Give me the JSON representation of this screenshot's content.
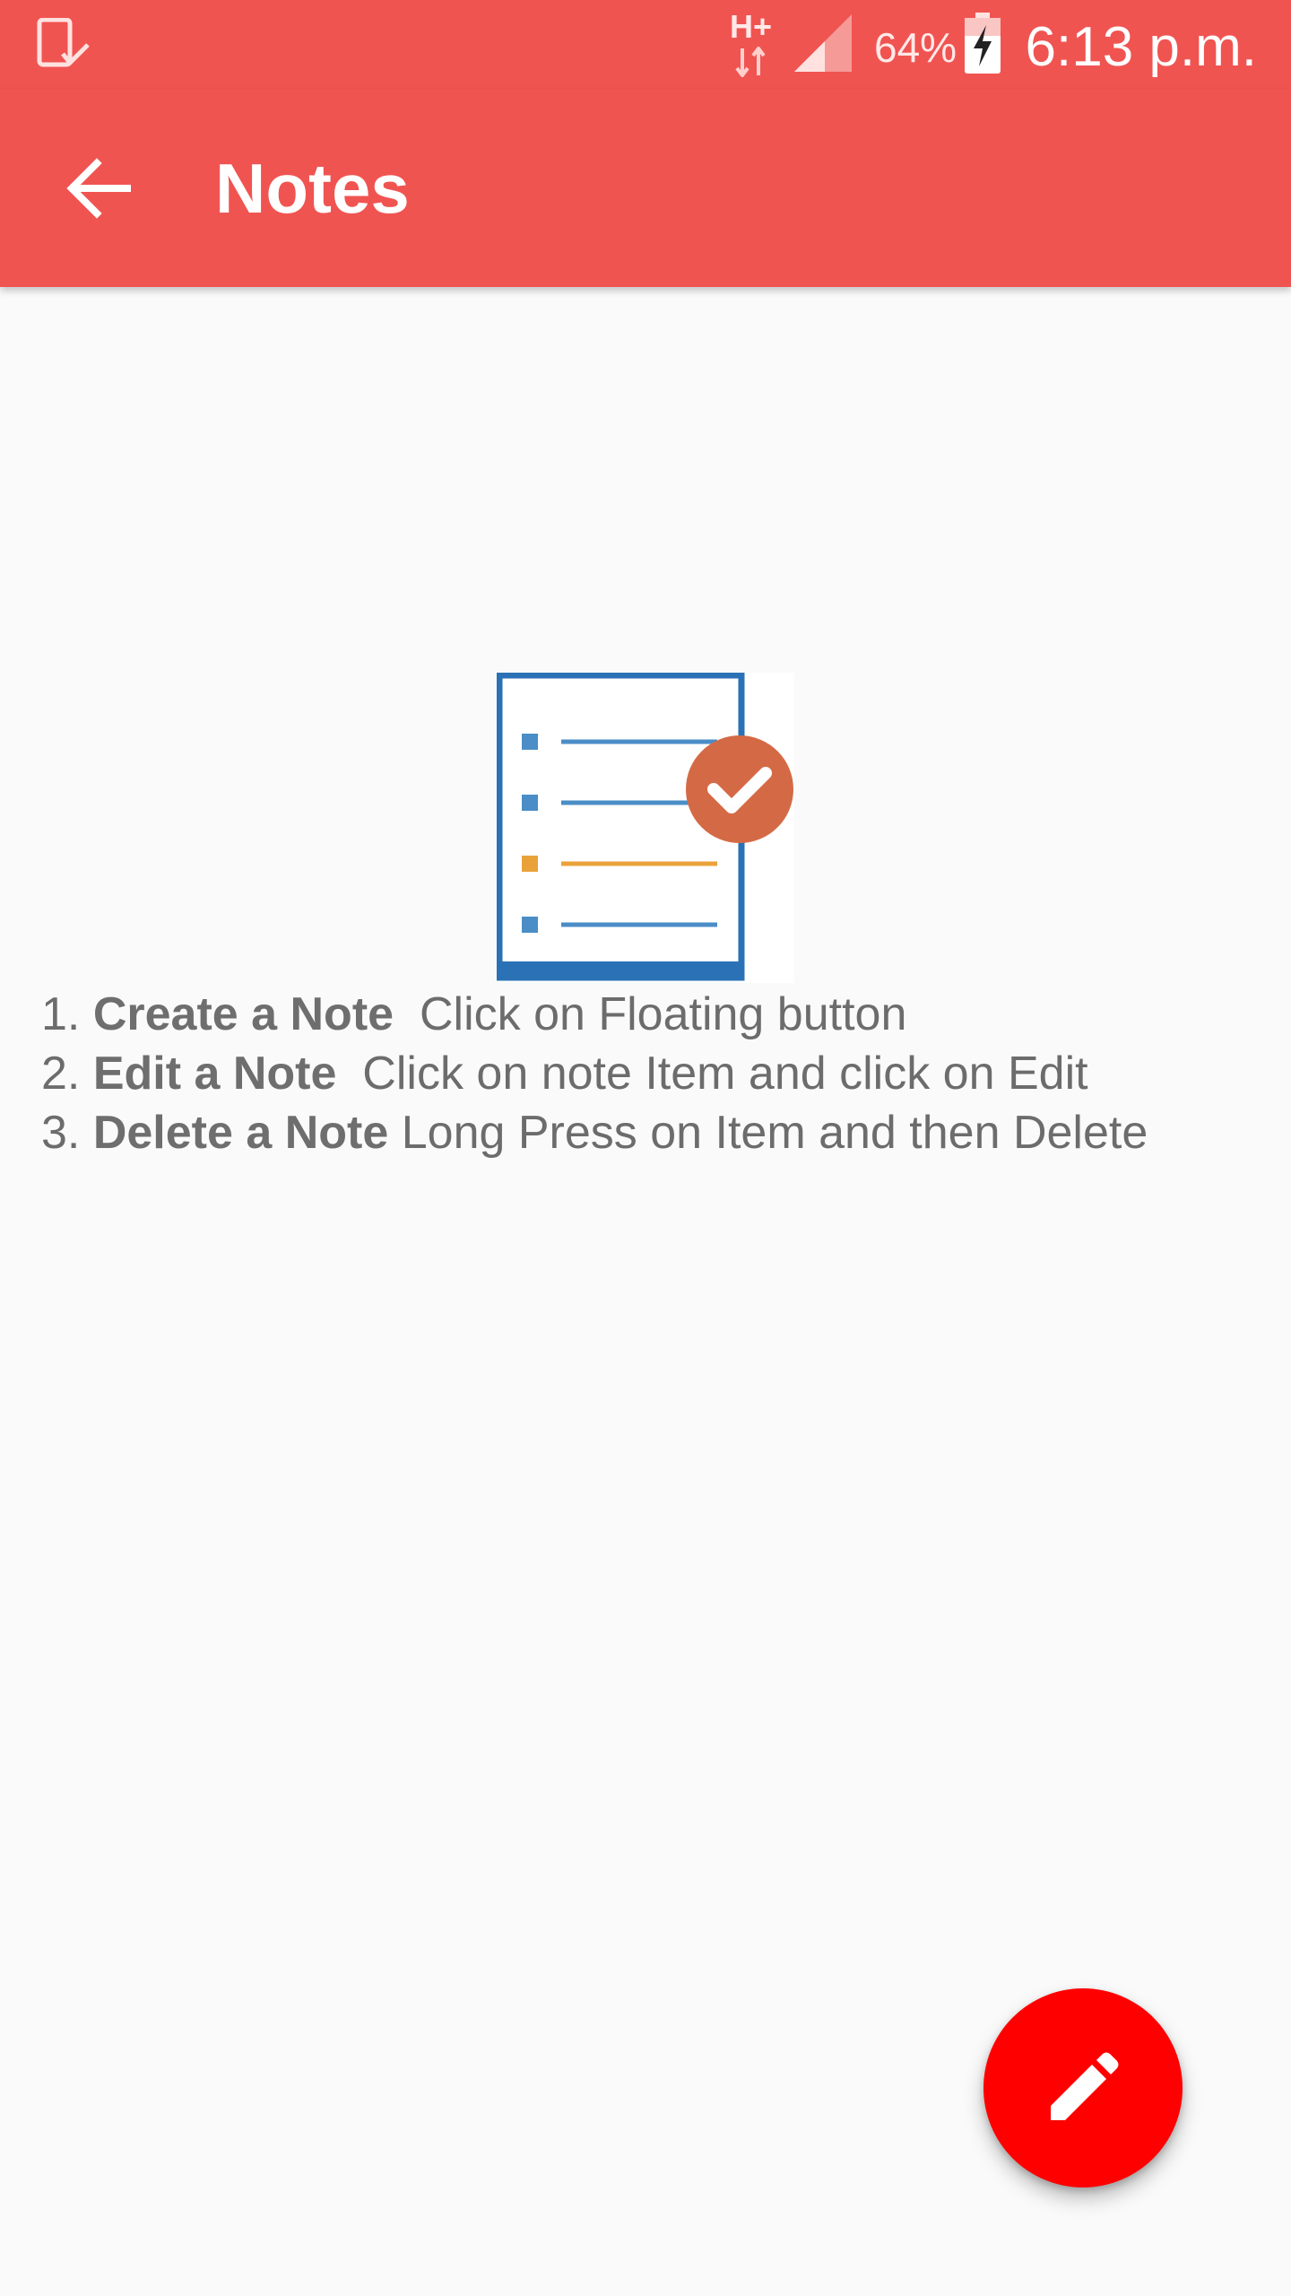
{
  "status_bar": {
    "network_type": "H+",
    "battery": "64%",
    "time": "6:13 p.m.",
    "icons": [
      "device-check-icon",
      "data-arrows-icon",
      "signal-icon",
      "battery-charging-icon"
    ]
  },
  "app_bar": {
    "title": "Notes",
    "back_icon": "arrow-back-icon"
  },
  "hero": {
    "icon": "checklist-icon"
  },
  "instructions": [
    {
      "number": "1.",
      "title": "Create a Note",
      "text": "  Click on Floating button"
    },
    {
      "number": "2.",
      "title": "Edit a Note",
      "text": "  Click on note Item and click on Edit"
    },
    {
      "number": "3.",
      "title": "Delete a Note",
      "text": " Long Press on Item and then Delete"
    }
  ],
  "fab": {
    "icon": "pencil-icon"
  },
  "colors": {
    "primary": "#f05451",
    "fab": "#ff0000",
    "background": "#fafafa",
    "text": "#6c6c6c",
    "check_circle": "#d46a45",
    "list_blue": "#4a8dc7",
    "list_orange": "#e9a23a"
  }
}
